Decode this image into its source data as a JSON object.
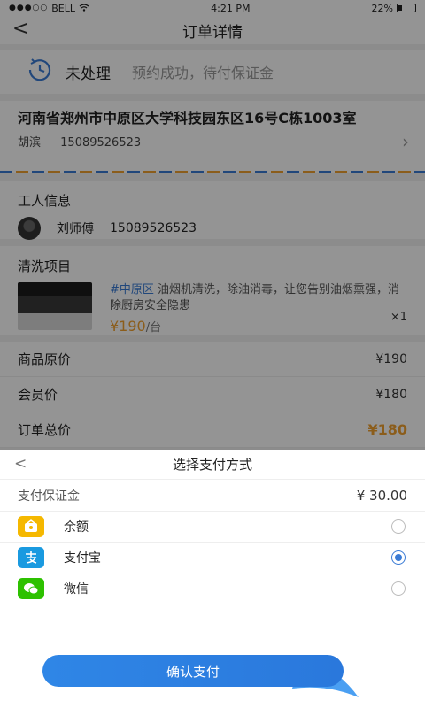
{
  "status_bar": {
    "carrier": "BELL",
    "time": "4:21 PM",
    "battery": "22%"
  },
  "nav": {
    "title": "订单详情",
    "back": "<"
  },
  "order_status": {
    "main": "未处理",
    "sub": "预约成功，待付保证金"
  },
  "address": {
    "text": "河南省郑州市中原区大学科技园东区16号C栋1003室",
    "name": "胡滨",
    "phone": "15089526523"
  },
  "worker": {
    "section_title": "工人信息",
    "name": "刘师傅",
    "phone": "15089526523"
  },
  "cleaning": {
    "section_title": "清洗项目",
    "tag": "#中原区",
    "description": "油烟机清洗，除油消毒，让您告别油烟熏强，消除厨房安全隐患",
    "price": "¥190",
    "unit": "/台",
    "qty": "×1"
  },
  "prices": [
    {
      "label": "商品原价",
      "value": "¥190"
    },
    {
      "label": "会员价",
      "value": "¥180"
    },
    {
      "label": "订单总价",
      "value": "¥180"
    }
  ],
  "payment_sheet": {
    "title": "选择支付方式",
    "back": "<",
    "deposit_label": "支付保证金",
    "deposit_amount": "¥ 30.00",
    "methods": [
      {
        "label": "余额",
        "icon": "wallet-icon",
        "selected": false
      },
      {
        "label": "支付宝",
        "icon": "alipay-icon",
        "selected": true
      },
      {
        "label": "微信",
        "icon": "wechat-icon",
        "selected": false
      }
    ],
    "confirm_label": "确认支付"
  },
  "colors": {
    "accent": "#3a7bd5",
    "price": "#f0a030",
    "alipay": "#1a9ae0",
    "wechat": "#2dc100",
    "balance": "#f5b800"
  }
}
